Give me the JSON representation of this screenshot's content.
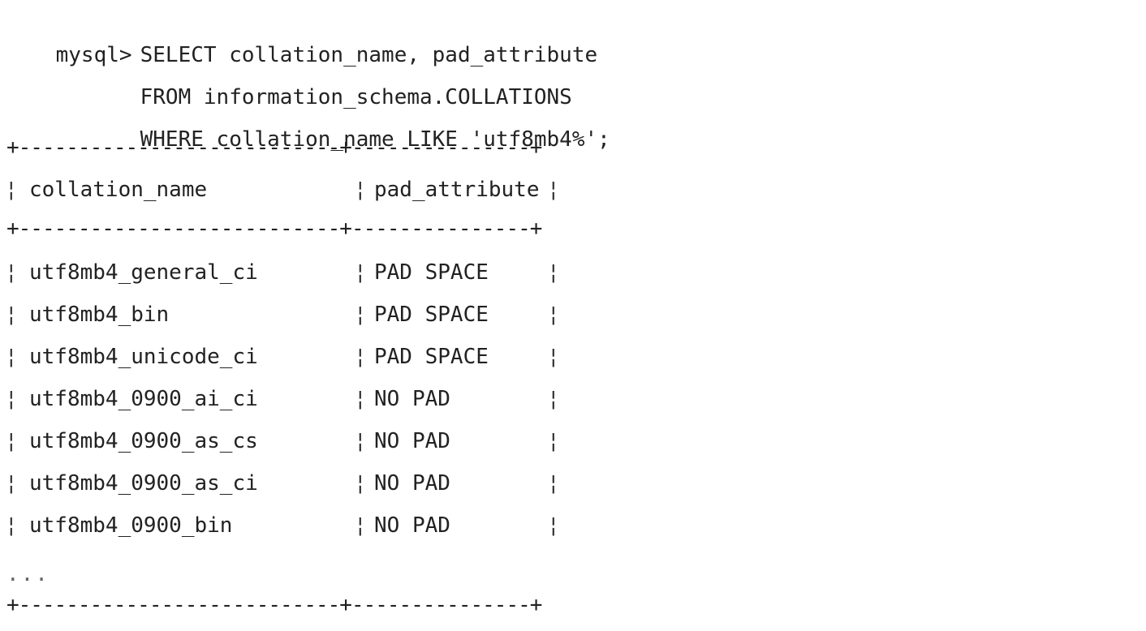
{
  "query": {
    "prompt": "mysql>",
    "line1": "SELECT collation_name, pad_attribute",
    "line2": "FROM information_schema.COLLATIONS",
    "line3": "WHERE collation_name LIKE 'utf8mb4%';"
  },
  "table": {
    "border_line": "+---------------------------+---------------+",
    "separator_char": "¦",
    "columns": [
      "collation_name",
      "pad_attribute"
    ],
    "rows": [
      [
        "utf8mb4_general_ci",
        "PAD SPACE"
      ],
      [
        "utf8mb4_bin",
        "PAD SPACE"
      ],
      [
        "utf8mb4_unicode_ci",
        "PAD SPACE"
      ],
      [
        "utf8mb4_0900_ai_ci",
        "NO PAD"
      ],
      [
        "utf8mb4_0900_as_cs",
        "NO PAD"
      ],
      [
        "utf8mb4_0900_as_ci",
        "NO PAD"
      ],
      [
        "utf8mb4_0900_bin",
        "NO PAD"
      ]
    ],
    "ellipsis": "..."
  }
}
